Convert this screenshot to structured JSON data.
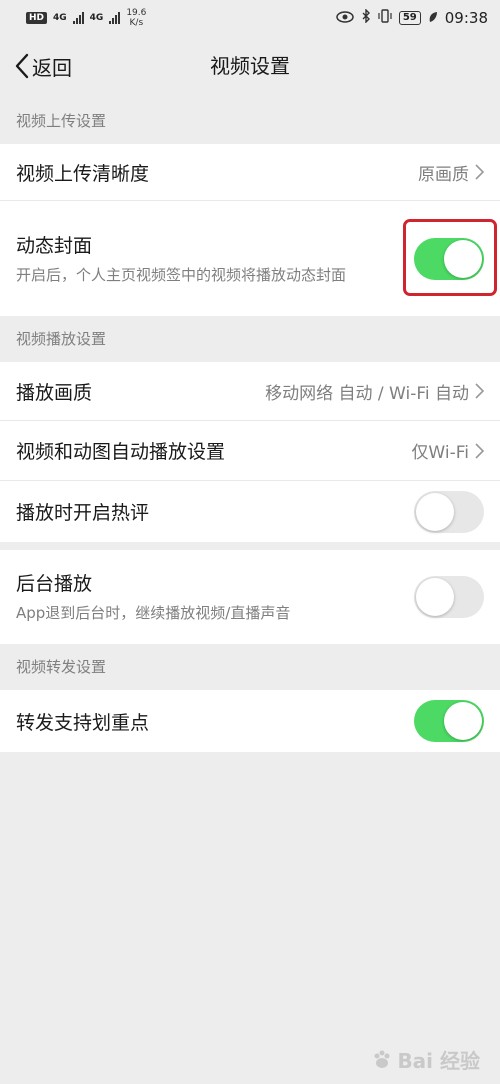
{
  "status_bar": {
    "hd": "HD",
    "net1": "4G",
    "net2": "4G",
    "speed_value": "19.6",
    "speed_unit": "K/s",
    "battery": "59",
    "time": "09:38"
  },
  "nav": {
    "back_label": "返回",
    "title": "视频设置"
  },
  "sections": {
    "upload": {
      "header": "视频上传设置",
      "quality_title": "视频上传清晰度",
      "quality_value": "原画质",
      "dynamic_cover_title": "动态封面",
      "dynamic_cover_desc": "开启后，个人主页视频签中的视频将播放动态封面",
      "dynamic_cover_on": true
    },
    "playback": {
      "header": "视频播放设置",
      "quality_title": "播放画质",
      "quality_value": "移动网络 自动 / Wi-Fi 自动",
      "autoplay_title": "视频和动图自动播放设置",
      "autoplay_value": "仅Wi-Fi",
      "hot_comments_title": "播放时开启热评",
      "hot_comments_on": false
    },
    "background": {
      "title": "后台播放",
      "desc": "App退到后台时，继续播放视频/直播声音",
      "on": false
    },
    "forward": {
      "header": "视频转发设置",
      "highlight_title": "转发支持划重点",
      "highlight_on": true
    }
  },
  "colors": {
    "toggle_on": "#4cd964",
    "toggle_off": "#e7e7e7",
    "highlight_border": "#d0242f"
  },
  "watermark": "Bai 经验"
}
